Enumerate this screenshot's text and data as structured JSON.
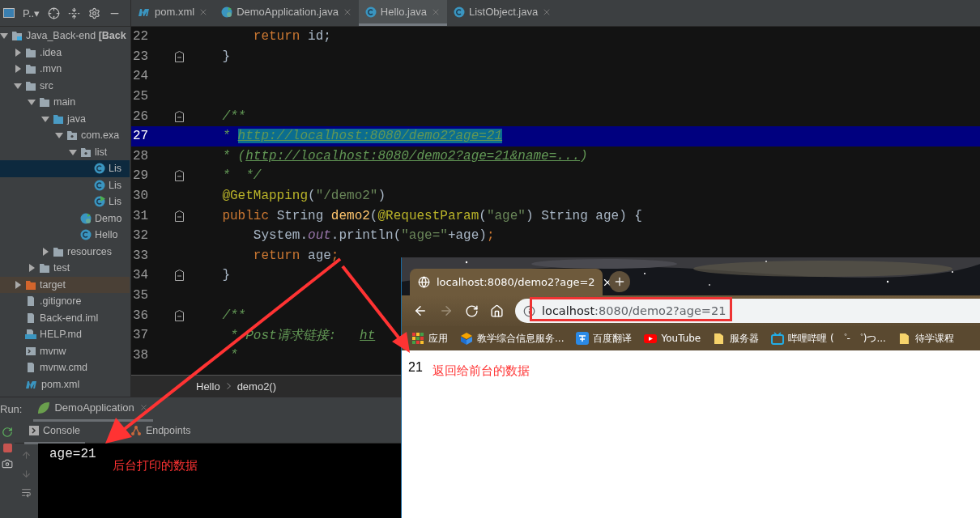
{
  "project_toolbar": {
    "title": "P..▾"
  },
  "project_tree": [
    {
      "label": "Java_Back-end **[Back**",
      "kind": "module",
      "expanded": true,
      "selected": false,
      "children": [
        {
          "label": ".idea",
          "kind": "folder",
          "expanded": false,
          "selected": false
        },
        {
          "label": ".mvn",
          "kind": "folder",
          "expanded": false,
          "selected": false
        },
        {
          "label": "src",
          "kind": "folder",
          "expanded": true,
          "selected": false,
          "children": [
            {
              "label": "main",
              "kind": "folder",
              "expanded": true,
              "selected": false,
              "children": [
                {
                  "label": "java",
                  "kind": "source",
                  "expanded": true,
                  "selected": false,
                  "children": [
                    {
                      "label": "com.exa",
                      "kind": "package",
                      "expanded": true,
                      "selected": false,
                      "children": [
                        {
                          "label": "list",
                          "kind": "package",
                          "expanded": true,
                          "selected": false,
                          "children": [
                            {
                              "label": "Lis",
                              "kind": "class",
                              "selected": true
                            },
                            {
                              "label": "Lis",
                              "kind": "class",
                              "selected": false
                            },
                            {
                              "label": "Lis",
                              "kind": "runnable",
                              "selected": false
                            }
                          ]
                        },
                        {
                          "label": "Demo",
                          "kind": "spring",
                          "selected": false
                        },
                        {
                          "label": "Hello",
                          "kind": "class",
                          "selected": false
                        }
                      ]
                    }
                  ]
                },
                {
                  "label": "resources",
                  "kind": "resources",
                  "expanded": false,
                  "selected": false
                }
              ]
            },
            {
              "label": "test",
              "kind": "folder",
              "expanded": false,
              "selected": false
            }
          ]
        },
        {
          "label": "target",
          "kind": "excluded",
          "expanded": false,
          "selected": false
        },
        {
          "label": ".gitignore",
          "kind": "file",
          "selected": false
        },
        {
          "label": "Back-end.iml",
          "kind": "file",
          "selected": false
        },
        {
          "label": "HELP.md",
          "kind": "markdown",
          "selected": false
        },
        {
          "label": "mvnw",
          "kind": "script",
          "selected": false
        },
        {
          "label": "mvnw.cmd",
          "kind": "file",
          "selected": false
        },
        {
          "label": "pom.xml",
          "kind": "maven",
          "selected": false
        }
      ]
    }
  ],
  "editor_tabs": [
    {
      "label": "pom.xml",
      "kind": "maven",
      "selected": false
    },
    {
      "label": "DemoApplication.java",
      "kind": "spring",
      "selected": false
    },
    {
      "label": "Hello.java",
      "kind": "class",
      "selected": true
    },
    {
      "label": "ListObject.java",
      "kind": "class",
      "selected": false
    }
  ],
  "code_lines": [
    {
      "number": "22",
      "fold": false,
      "current": false,
      "tokens": [
        {
          "kind": "keyword",
          "text": "        return "
        },
        {
          "kind": "plain",
          "text": "id;"
        }
      ]
    },
    {
      "number": "23",
      "fold": true,
      "current": false,
      "tokens": [
        {
          "kind": "plain",
          "text": "    }"
        }
      ]
    },
    {
      "number": "24",
      "fold": false,
      "current": false
    },
    {
      "number": "25",
      "fold": false,
      "current": false
    },
    {
      "number": "26",
      "fold": true,
      "current": false,
      "tokens": [
        {
          "kind": "comment",
          "text": "    /**"
        }
      ]
    },
    {
      "number": "27",
      "fold": false,
      "current": true,
      "tokens": [
        {
          "kind": "comment",
          "text": "    * "
        },
        {
          "kind": "selected-link",
          "text": "http://localhost:8080/demo2?age=21"
        }
      ]
    },
    {
      "number": "28",
      "fold": false,
      "current": false,
      "tokens": [
        {
          "kind": "comment",
          "text": "    * ("
        },
        {
          "kind": "link",
          "text": "http://localhost:8080/demo2?age=21&name=..."
        },
        {
          "kind": "comment",
          "text": ")"
        }
      ]
    },
    {
      "number": "29",
      "fold": true,
      "current": false,
      "tokens": [
        {
          "kind": "comment",
          "text": "    *  */"
        }
      ]
    },
    {
      "number": "30",
      "fold": false,
      "current": false,
      "tokens": [
        {
          "kind": "annotation",
          "text": "    @GetMapping"
        },
        {
          "kind": "plain",
          "text": "("
        },
        {
          "kind": "string",
          "text": "\"/demo2\""
        },
        {
          "kind": "plain",
          "text": ")"
        }
      ]
    },
    {
      "number": "31",
      "fold": true,
      "current": false,
      "tokens": [
        {
          "kind": "keyword",
          "text": "    public "
        },
        {
          "kind": "plain",
          "text": "String "
        },
        {
          "kind": "method",
          "text": "demo2"
        },
        {
          "kind": "plain",
          "text": "("
        },
        {
          "kind": "annotation",
          "text": "@RequestParam"
        },
        {
          "kind": "plain",
          "text": "("
        },
        {
          "kind": "string",
          "text": "\"age\""
        },
        {
          "kind": "plain",
          "text": ") String age) {"
        }
      ]
    },
    {
      "number": "32",
      "fold": false,
      "current": false,
      "tokens": [
        {
          "kind": "plain",
          "text": "        System."
        },
        {
          "kind": "static",
          "text": "out"
        },
        {
          "kind": "plain",
          "text": ".println("
        },
        {
          "kind": "string",
          "text": "\"age=\""
        },
        {
          "kind": "plain",
          "text": "+age)"
        },
        {
          "kind": "keyword",
          "text": ";"
        }
      ]
    },
    {
      "number": "33",
      "fold": false,
      "current": false,
      "tokens": [
        {
          "kind": "keyword",
          "text": "        return "
        },
        {
          "kind": "plain",
          "text": "age"
        },
        {
          "kind": "keyword",
          "text": ";"
        }
      ]
    },
    {
      "number": "34",
      "fold": true,
      "current": false,
      "tokens": [
        {
          "kind": "plain",
          "text": "    }"
        }
      ]
    },
    {
      "number": "35",
      "fold": false,
      "current": false
    },
    {
      "number": "36",
      "fold": true,
      "current": false,
      "tokens": [
        {
          "kind": "comment",
          "text": "    /**"
        }
      ]
    },
    {
      "number": "37",
      "fold": false,
      "current": false,
      "tokens": [
        {
          "kind": "comment",
          "text": "     * Post请求链接:   "
        },
        {
          "kind": "link",
          "text": "ht"
        }
      ]
    },
    {
      "number": "38",
      "fold": false,
      "current": false,
      "tokens": [
        {
          "kind": "comment",
          "text": "     *"
        }
      ]
    }
  ],
  "breadcrumb": [
    "Hello",
    "demo2()"
  ],
  "run_panel": {
    "label": "Run:",
    "config": "DemoApplication",
    "tabs": [
      {
        "label": "Console",
        "kind": "console",
        "selected": true
      },
      {
        "label": "Endpoints",
        "kind": "endpoints",
        "selected": false
      }
    ],
    "output": "age=21"
  },
  "annotations": {
    "console_note": "后台打印的数据",
    "page_note": "返回给前台的数据"
  },
  "browser": {
    "tab_title": "localhost:8080/demo2?age=2",
    "address_host": "localhost",
    "address_path": ":8080/demo2?age=21",
    "bookmarks": [
      {
        "label": "应用",
        "kind": "apps"
      },
      {
        "label": "教学综合信息服务...",
        "kind": "cube"
      },
      {
        "label": "百度翻译",
        "kind": "translate"
      },
      {
        "label": "YouTube",
        "kind": "youtube"
      },
      {
        "label": "服务器",
        "kind": "folder"
      },
      {
        "label": "哔哩哔哩 ( ゜- ゜)つ...",
        "kind": "tv"
      },
      {
        "label": "待学课程",
        "kind": "folder"
      }
    ],
    "page_text": "21"
  }
}
